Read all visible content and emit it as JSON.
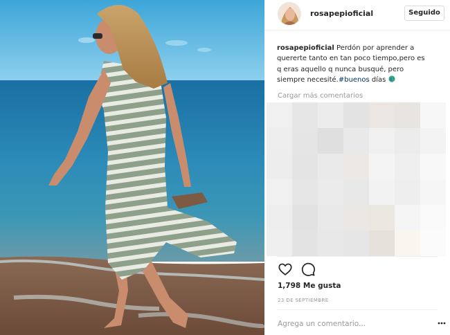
{
  "post": {
    "username": "rosapepioficial",
    "follow_label": "Seguido",
    "caption_user": "rosapepioficial",
    "caption_text": "Perdón por aprender a quererte tanto en tan poco tiempo,pero es q eras aquello q nunca busqué, pero siempre necesité.",
    "caption_hashtag": "#buenos",
    "caption_tail": "días",
    "load_more_label": "Cargar más comentarios",
    "likes_text": "1,798 Me gusta",
    "date_text": "23 de septiembre",
    "comment_placeholder": "Agrega un comentario..."
  },
  "icons": {
    "avatar": "avatar-photo",
    "like": "heart-outline-icon",
    "comment": "speech-bubble-icon",
    "more": "ellipsis-icon",
    "emoji": "earth-globe-emoji"
  },
  "colors": {
    "hashtag": "#003569",
    "muted_text": "#999999",
    "border": "#dbdbdb"
  }
}
